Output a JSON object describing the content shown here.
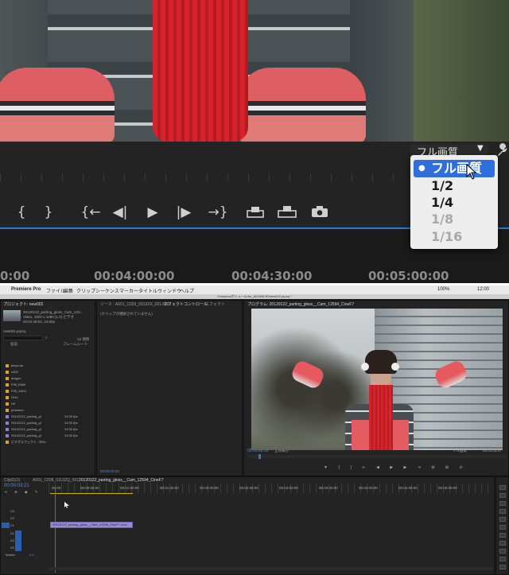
{
  "zoomed_view": {
    "quality_label": "フル画質",
    "quality_menu": [
      {
        "label": "フル画質",
        "selected": true,
        "enabled": true
      },
      {
        "label": "1/2",
        "selected": false,
        "enabled": true
      },
      {
        "label": "1/4",
        "selected": false,
        "enabled": true
      },
      {
        "label": "1/8",
        "selected": false,
        "enabled": false
      },
      {
        "label": "1/16",
        "selected": false,
        "enabled": false
      }
    ],
    "controls": [
      "{",
      "}",
      "{←",
      "◀|",
      "▶",
      "|▶",
      "→}"
    ],
    "ruler_times": [
      "0:00",
      "00:04:00:00",
      "00:04:30:00",
      "00:05:00:00"
    ],
    "accent_color": "#2a7ad6",
    "selection_color": "#2f6fdc"
  },
  "app": {
    "menu": [
      "Premiere Pro",
      "ファイル",
      "編集",
      "クリップ",
      "シーケンス",
      "マーカー",
      "タイトル",
      "ウィンドウ",
      "ヘルプ"
    ],
    "window_title": "/Volumes/ボリューム/for_ADOBE/IR/new002.prproj *",
    "clock": "12:00",
    "battery": "100%"
  },
  "project_panel": {
    "tab": "プロジェクト: new002",
    "clip_info": [
      "20120122_parting_gloss_Cam_12S...",
      "Video, 1920 x 1080 (1.0) ビデオ",
      "00:02:49:02, 24.00p"
    ],
    "project_name": "new002.prproj",
    "item_count": "12 項目",
    "col_name": "名前",
    "col_rate": "フレームレート",
    "items": [
      {
        "name": "binyo-hk",
        "color": "#e0a030",
        "rate": ""
      },
      {
        "name": "c300",
        "color": "#e0a030",
        "rate": ""
      },
      {
        "name": "dragon",
        "color": "#e0a030",
        "rate": ""
      },
      {
        "name": "F55_RAW",
        "color": "#e0a030",
        "rate": ""
      },
      {
        "name": "F55_XAVC",
        "color": "#e0a030",
        "rate": ""
      },
      {
        "name": "GH4",
        "color": "#e0a030",
        "rate": ""
      },
      {
        "name": "HK",
        "color": "#e0a030",
        "rate": ""
      },
      {
        "name": "phantom",
        "color": "#e0a030",
        "rate": ""
      },
      {
        "name": "20120122_parting_gl",
        "color": "#8a7fd0",
        "rate": "24.00 fps"
      },
      {
        "name": "20120122_parting_gl",
        "color": "#8a7fd0",
        "rate": "24.00 fps"
      },
      {
        "name": "20120122_parting_gl",
        "color": "#8a7fd0",
        "rate": "24.00 fps"
      },
      {
        "name": "20120122_parting_gl",
        "color": "#8a7fd0",
        "rate": "24.00 fps"
      },
      {
        "name": "ビデオエフェクト : RED",
        "color": "#e0a030",
        "rate": ""
      }
    ]
  },
  "source_panel": {
    "tabs": [
      "ソース : A001_C003_0313XX_001.R3D",
      "エフェクトコントロール",
      "エフェクト"
    ],
    "empty_msg": "(クリップが選択されていません)",
    "timecode": "00:00:00:00"
  },
  "program_panel": {
    "tab": "プログラム: 20120122_parting_gloss__Cam_12594_CineF7",
    "timecode": "00:00:00:00",
    "fit": "全体表示",
    "quality": "フル画質",
    "duration": "00:01:03:07"
  },
  "timeline": {
    "tabs": [
      "Clip01(2)",
      "A001_C008_0113ZQ_001",
      "20120122_parting_gloss__Cam_12594_CineF7"
    ],
    "timecode": "00:00:03:21",
    "times": [
      "00:00",
      "00:00:30:00",
      "00:01:00:00",
      "00:01:30:00",
      "00:02:00:00",
      "00:02:30:00",
      "00:03:00:00",
      "00:03:30:00",
      "00:04:00:00",
      "00:04:30:00",
      "00:05:00:00"
    ],
    "tracks": [
      "V3",
      "V2",
      "V1",
      "A1",
      "A2",
      "A3",
      "Master"
    ],
    "clip_label": "20120122_parting_gloss__Cam_12594_CineF7.mov",
    "master_value": "0.0"
  }
}
